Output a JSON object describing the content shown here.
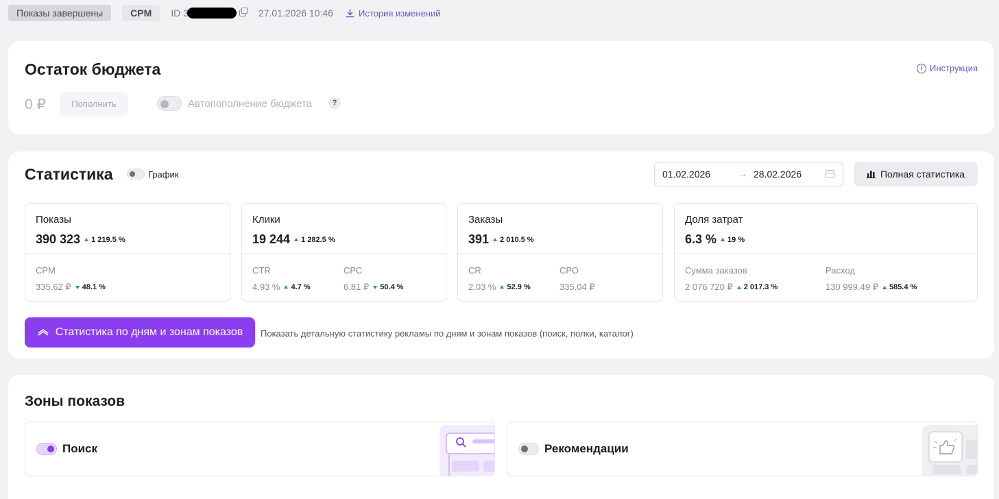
{
  "topbar": {
    "status_badge": "Показы завершены",
    "type_badge": "CPM",
    "id_prefix": "ID 3",
    "timestamp": "27.01.2026 10:46",
    "history_link": "История изменений"
  },
  "budget": {
    "title": "Остаток бюджета",
    "instruction_link": "Инструкция",
    "amount": "0 ₽",
    "topup_label": "Пополнить",
    "autotopup_label": "Автопополнение бюджета",
    "help": "?"
  },
  "stats": {
    "title": "Статистика",
    "chart_toggle_label": "График",
    "date_from": "01.02.2026",
    "date_arrow": "→",
    "date_to": "28.02.2026",
    "full_stats_label": "Полная статистика",
    "metrics": [
      {
        "title": "Показы",
        "value": "390 323",
        "change": "1 219.5 %",
        "trend": "up-good",
        "subs": [
          {
            "label": "CPM",
            "value": "335.62 ₽",
            "change": "48.1 %",
            "trend": "down-good"
          }
        ]
      },
      {
        "title": "Клики",
        "value": "19 244",
        "change": "1 282.5 %",
        "trend": "up-good",
        "subs": [
          {
            "label": "CTR",
            "value": "4.93 %",
            "change": "4.7 %",
            "trend": "up-good"
          },
          {
            "label": "CPC",
            "value": "6.81 ₽",
            "change": "50.4 %",
            "trend": "down-good"
          }
        ]
      },
      {
        "title": "Заказы",
        "value": "391",
        "change": "2 010.5 %",
        "trend": "up-good",
        "subs": [
          {
            "label": "CR",
            "value": "2.03 %",
            "change": "52.9 %",
            "trend": "up-good"
          },
          {
            "label": "CPO",
            "value": "335.04 ₽",
            "change": "",
            "trend": ""
          }
        ]
      },
      {
        "title": "Доля затрат",
        "value": "6.3 %",
        "change": "19 %",
        "trend": "up-bad",
        "subs": [
          {
            "label": "Сумма заказов",
            "value": "2 076 720 ₽",
            "change": "2 017.3 %",
            "trend": "up-good"
          },
          {
            "label": "Расход",
            "value": "130 999.49 ₽",
            "change": "585.4 %",
            "trend": "up-bad"
          }
        ]
      }
    ],
    "details_button": "Статистика по дням и зонам показов",
    "details_hint": "Показать детальную статистику рекламы по дням и зонам показов (поиск, полки, каталог)"
  },
  "zones": {
    "title": "Зоны показов",
    "items": [
      {
        "label": "Поиск",
        "enabled": true
      },
      {
        "label": "Рекомендации",
        "enabled": false
      }
    ]
  },
  "colors": {
    "accent": "#8b3df0",
    "link": "#5b5fc7",
    "up_good": "#1fa65a",
    "up_bad": "#e23b3b"
  }
}
